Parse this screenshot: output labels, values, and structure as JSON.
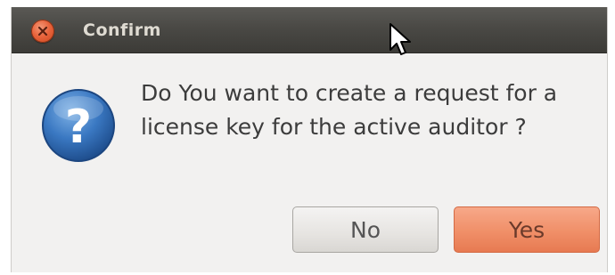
{
  "window": {
    "title": "Confirm",
    "close_icon": "close-icon"
  },
  "dialog": {
    "message": "Do You want to create a request for a\nlicense key for the active auditor ?",
    "icon": "question-icon"
  },
  "buttons": {
    "no_label": "No",
    "yes_label": "Yes"
  },
  "colors": {
    "titlebar": "#3c3b37",
    "title_text": "#dfdbd2",
    "close_button": "#e8633b",
    "dialog_bg": "#f2f1f0",
    "yes_button": "#f08f68",
    "question_icon": "#3a6fb0"
  }
}
